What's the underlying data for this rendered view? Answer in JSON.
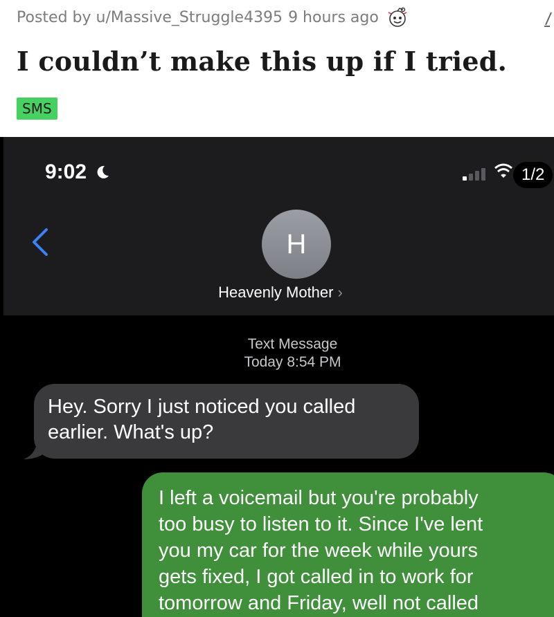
{
  "post": {
    "meta": "Posted by u/Massive_Struggle4395",
    "age": "9 hours ago",
    "title": "I couldn’t make this up if I tried.",
    "flair": "SMS",
    "flair_color": "#46d160"
  },
  "phone": {
    "status": {
      "time": "9:02",
      "pager": "1/2"
    },
    "contact": {
      "initial": "H",
      "name": "Heavenly Mother"
    },
    "thread": {
      "type": "Text Message",
      "timestamp": "Today 8:54 PM",
      "incoming": {
        "lines": [
          "Hey. Sorry I just noticed you called",
          "earlier. What's up?"
        ],
        "color": "#3a3a3c"
      },
      "outgoing": {
        "lines": [
          "I left a voicemail but you're probably",
          "too busy to listen to it. Since I've lent",
          "you my car for the week while yours",
          "gets fixed, I got called in to work for",
          "tomorrow and Friday, well not called"
        ],
        "color": "#3f8f3b"
      }
    }
  }
}
